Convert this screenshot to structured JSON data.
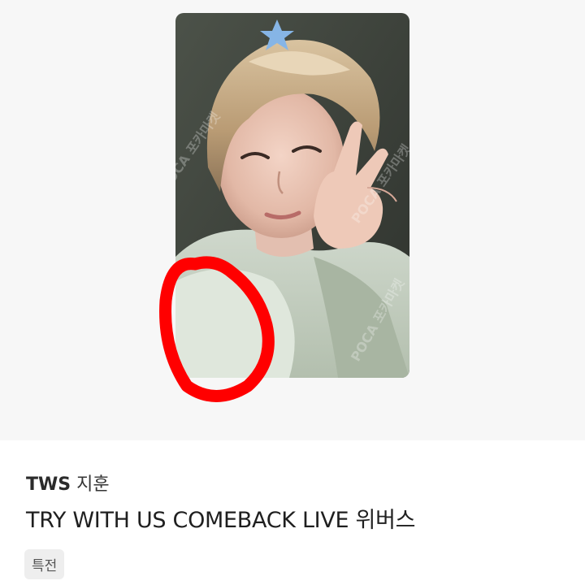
{
  "product": {
    "group": "TWS",
    "member": "지훈",
    "title": "TRY WITH US COMEBACK LIVE 위버스",
    "tag": "특전",
    "watermark": "POCA 포카마켓"
  },
  "colors": {
    "image_background": "#f7f7f7",
    "highlight_circle": "#ff0000",
    "tag_background": "#eeeeee"
  }
}
